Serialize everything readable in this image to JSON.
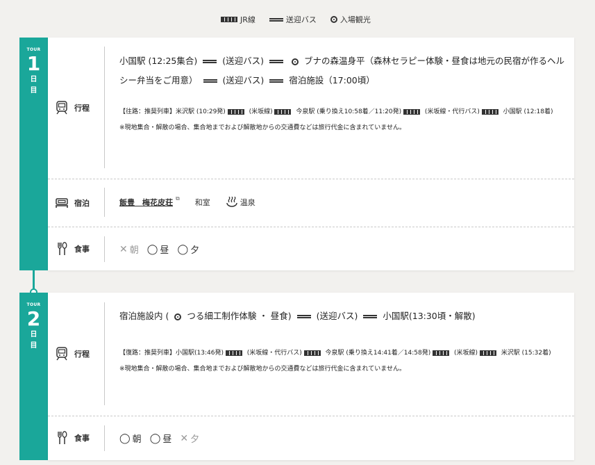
{
  "legend": {
    "rail_label": "JR線",
    "bus_label": "送迎バス",
    "sightseeing_label": "入場観光"
  },
  "days": [
    {
      "tour_label": "TOUR",
      "number": "1",
      "suffix_1": "日",
      "suffix_2": "目",
      "itinerary_label": "行程",
      "route": {
        "start": "小国駅 (12:25集合)",
        "bus_1": "(送迎バス)",
        "activity": "ブナの森温身平（森林セラピー体験・昼食は地元の民宿が作るヘルシー弁当をご用意）",
        "bus_2": "(送迎バス)",
        "end": "宿泊施設（17:00頃）"
      },
      "train": {
        "head": "【往路：推奨列車】米沢駅 (10:29発)",
        "seg_1": "(米坂線)",
        "seg_2": "今泉駅 (乗り換え10:58着／11:20発)",
        "seg_3": "(米坂線・代行バス)",
        "seg_4": "小国駅 (12:18着)"
      },
      "note": "※現地集合・解散の場合、集合地までおよび解散地からの交通費などは旅行代金に含まれていません。",
      "lodging": {
        "label": "宿泊",
        "hotel": "飯豊　梅花皮荘",
        "ext_icon": "⧉",
        "room": "和室",
        "onsen": "温泉"
      },
      "meals_label": "食事",
      "meals": [
        {
          "mark": "✕",
          "name": "朝",
          "included": false
        },
        {
          "mark": "◯",
          "name": "昼",
          "included": true
        },
        {
          "mark": "◯",
          "name": "夕",
          "included": true
        }
      ]
    },
    {
      "tour_label": "TOUR",
      "number": "2",
      "suffix_1": "日",
      "suffix_2": "目",
      "itinerary_label": "行程",
      "route": {
        "start": "宿泊施設内 (",
        "activity": "つる細工制作体験 ・ 昼食)",
        "bus_1": "(送迎バス)",
        "end": "小国駅(13:30頃・解散)"
      },
      "train": {
        "head": "【復路：推奨列車】小国駅(13:46発)",
        "seg_1": "(米坂線・代行バス)",
        "seg_2": "今泉駅 (乗り換え14:41着／14:58発)",
        "seg_3": "(米坂線)",
        "seg_4": "米沢駅 (15:32着)"
      },
      "note": "※現地集合・解散の場合、集合地までおよび解散地からの交通費などは旅行代金に含まれていません。",
      "meals_label": "食事",
      "meals": [
        {
          "mark": "◯",
          "name": "朝",
          "included": true
        },
        {
          "mark": "◯",
          "name": "昼",
          "included": true
        },
        {
          "mark": "✕",
          "name": "夕",
          "included": false
        }
      ]
    }
  ],
  "icons": {
    "train": "train-icon",
    "bed": "bed-icon",
    "cutlery": "cutlery-icon",
    "onsen": "hot-spring-icon"
  },
  "colors": {
    "accent": "#1aa79a"
  }
}
